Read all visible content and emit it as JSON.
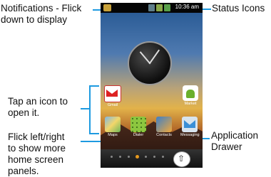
{
  "callouts": {
    "notifications": [
      "Notifications - Flick",
      "down to display"
    ],
    "status_icons": "Status Icons",
    "tap_icon": [
      "Tap an icon to",
      "open it."
    ],
    "flick": [
      "Flick left/right",
      "to show more",
      "home screen",
      "panels."
    ],
    "drawer": [
      "Application",
      "Drawer"
    ]
  },
  "phone": {
    "time": "10:36 am",
    "apps": [
      "Gmail",
      "Market",
      "Maps",
      "Dialer",
      "Contacts",
      "Messaging"
    ]
  },
  "colors": {
    "callout_line": "#1e9ae0"
  }
}
